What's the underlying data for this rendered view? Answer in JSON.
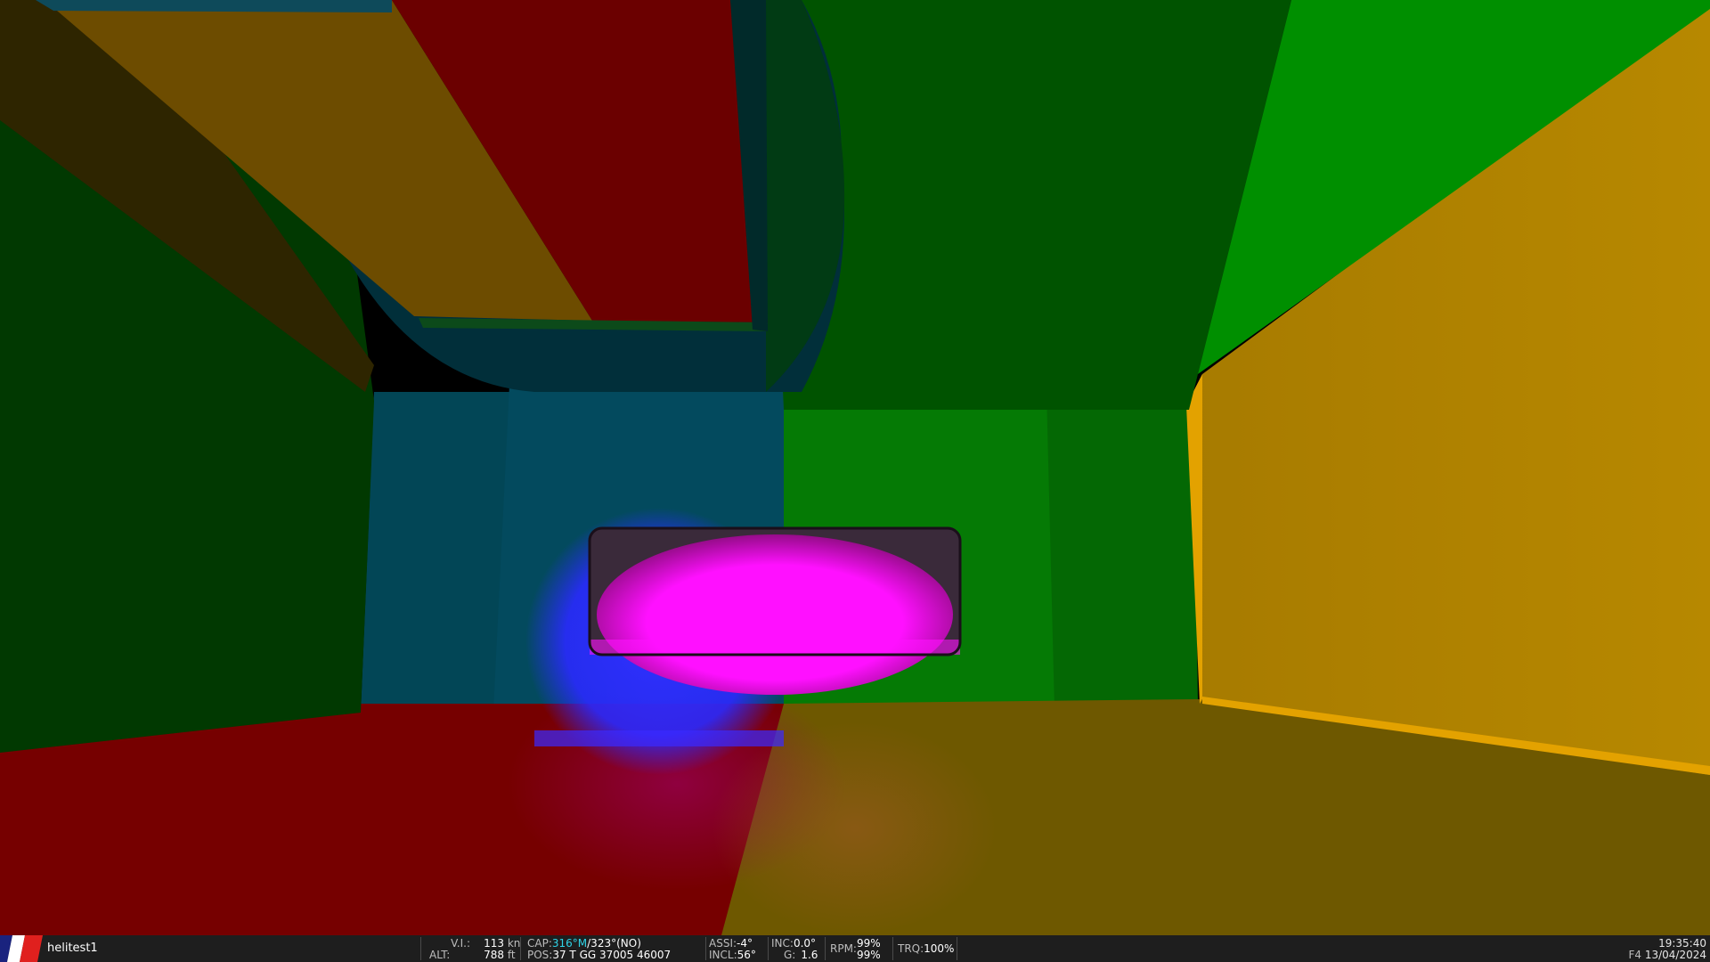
{
  "scene": {
    "colors": {
      "wall_left": "#013d01",
      "wall_back_left": "#024a5a",
      "wall_back_right": "#046f04",
      "wall_right": "#b18300",
      "floor_left": "#7a0000",
      "floor_right": "#6f5a00",
      "ceiling_red": "#6c0000",
      "ceiling_yellow": "#6f4d00",
      "ceiling_green": "#005400",
      "ceiling_bright_green": "#009000",
      "light_magenta": "#ff10ff",
      "light_blue": "#3030ff"
    }
  },
  "hud": {
    "callsign": "helitest1",
    "vi_label": "V.I.:",
    "vi_value": "113",
    "vi_unit": "kn",
    "alt_label": "ALT:",
    "alt_value": "788",
    "alt_unit": "ft",
    "cap_label": "CAP:",
    "cap_magnetic": "316°M",
    "cap_true": "/323°(NO)",
    "pos_label": "POS:",
    "pos_value": "37 T GG 37005 46007",
    "assi_label": "ASSI:",
    "assi_value": "-4°",
    "incl_label": "INCL:",
    "incl_value": "56°",
    "inc_label": "INC:",
    "inc_value": "0.0°",
    "g_label": "G:",
    "g_value": "1.6",
    "rpm_label": "RPM:",
    "rpm_value_1": "99%",
    "rpm_value_2": "99%",
    "trq_label": "TRQ:",
    "trq_value": "100%",
    "time": "19:35:40",
    "date_prefix": "F4",
    "date": "13/04/2024"
  }
}
